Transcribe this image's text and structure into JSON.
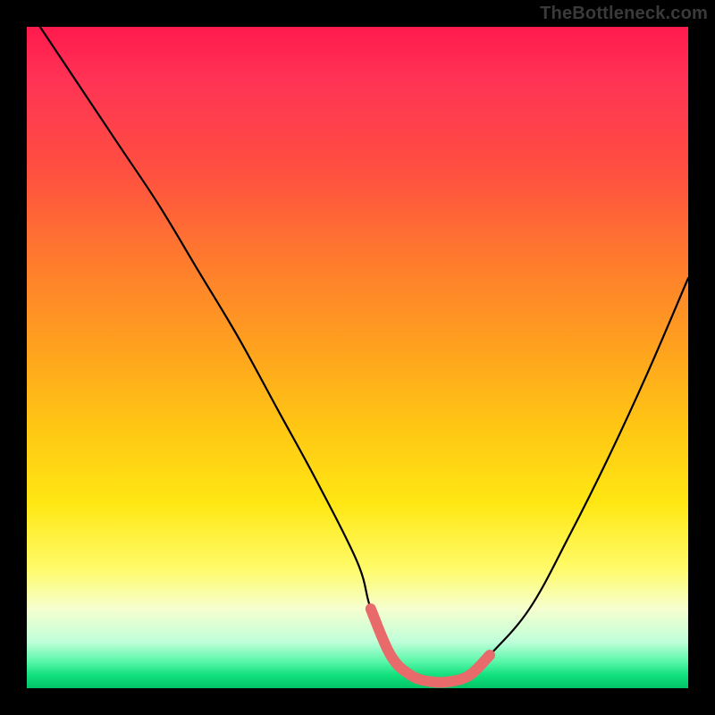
{
  "watermark": {
    "text": "TheBottleneck.com"
  },
  "chart_data": {
    "type": "line",
    "title": "",
    "xlabel": "",
    "ylabel": "",
    "xlim": [
      0,
      100
    ],
    "ylim": [
      0,
      100
    ],
    "grid": false,
    "legend": false,
    "series": [
      {
        "name": "bottleneck-curve",
        "color": "#000000",
        "x": [
          2,
          8,
          14,
          20,
          26,
          32,
          38,
          44,
          50,
          52,
          55,
          58,
          61,
          64,
          67,
          70,
          76,
          82,
          88,
          94,
          100
        ],
        "y": [
          100,
          91,
          82,
          73,
          63,
          53,
          42,
          31,
          19,
          12,
          5,
          2,
          1,
          1,
          2,
          5,
          12,
          23,
          35,
          48,
          62
        ]
      },
      {
        "name": "green-zone-highlight",
        "color": "#e96a6a",
        "x": [
          52,
          55,
          58,
          61,
          64,
          67,
          70
        ],
        "y": [
          12,
          5,
          2,
          1,
          1,
          2,
          5
        ]
      }
    ],
    "annotations": []
  }
}
